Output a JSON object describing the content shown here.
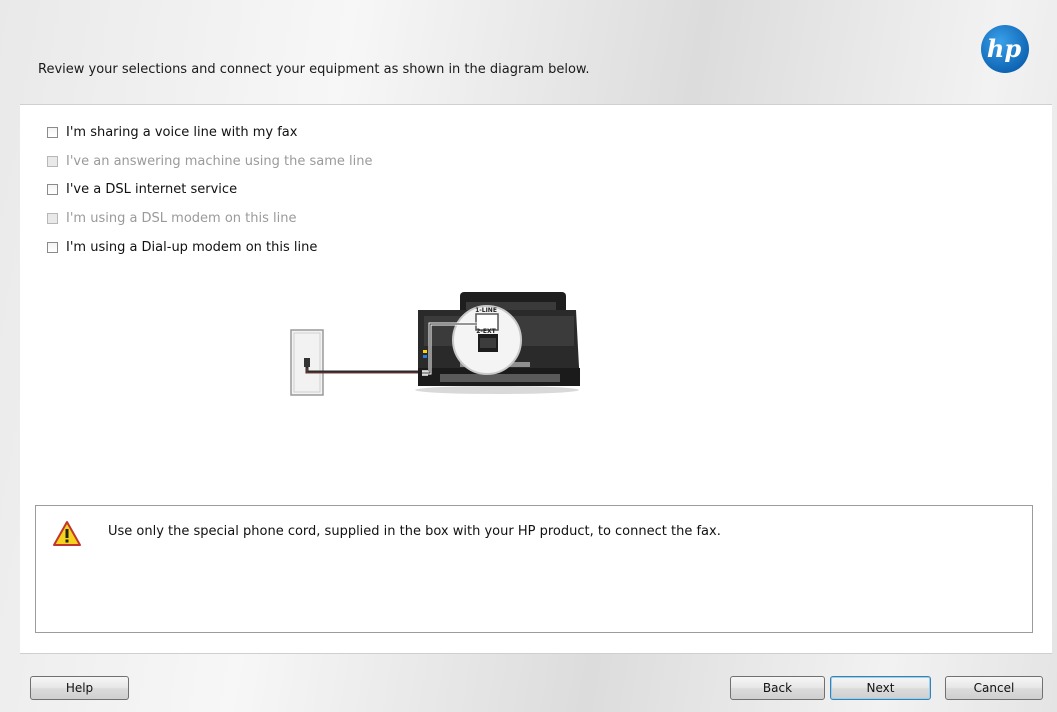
{
  "header": {
    "instruction": "Review your selections and connect your equipment as shown in the diagram below.",
    "logo_text": "hp"
  },
  "options": [
    {
      "label": "I'm sharing a voice line with my fax",
      "checked": false,
      "enabled": true
    },
    {
      "label": "I've an answering machine using the same line",
      "checked": false,
      "enabled": false
    },
    {
      "label": "I've a DSL internet service",
      "checked": false,
      "enabled": true
    },
    {
      "label": "I'm using a DSL modem on this line",
      "checked": false,
      "enabled": false
    },
    {
      "label": "I'm using a Dial-up modem on this line",
      "checked": false,
      "enabled": true
    }
  ],
  "diagram": {
    "port_1": "1-LINE",
    "port_2": "2-EXT"
  },
  "warning": {
    "icon": "warning-triangle-icon",
    "text": "Use only the special phone cord, supplied in the box with your HP product, to connect the fax."
  },
  "buttons": {
    "help": "Help",
    "back": "Back",
    "next": "Next",
    "cancel": "Cancel"
  },
  "colors": {
    "hp_blue": "#0a6bbf",
    "warning_yellow": "#f5d21d",
    "warning_border": "#c0362c",
    "disabled_text": "#9a9a9a"
  }
}
